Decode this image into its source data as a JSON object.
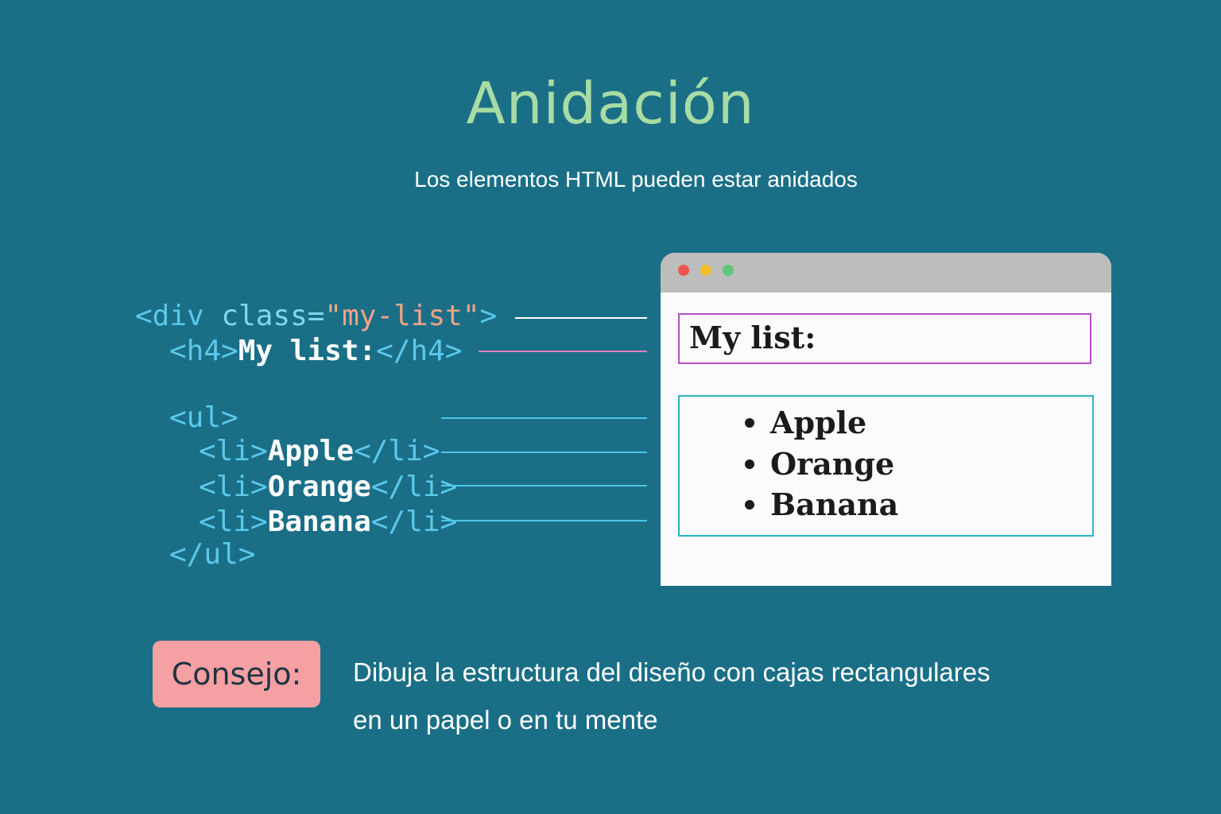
{
  "title": "Anidación",
  "subtitle": "Los elementos HTML pueden estar anidados",
  "code": {
    "div_open_tag": "<div",
    "div_class_attr": " class=",
    "div_class_value": "\"my-list\"",
    "div_close_bracket": ">",
    "h4_open": "<h4>",
    "h4_text": "My list:",
    "h4_close": "</h4>",
    "ul_open": "<ul>",
    "li_open": "<li>",
    "li_close": "</li>",
    "items": [
      "Apple",
      "Orange",
      "Banana"
    ],
    "ul_close": "</ul>"
  },
  "browser": {
    "heading": "My list:",
    "items": [
      "Apple",
      "Orange",
      "Banana"
    ]
  },
  "tip": {
    "label": "Consejo:",
    "line1": "Dibuja la estructura del diseño con cajas rectangulares",
    "line2": "en un papel o en tu mente"
  },
  "colors": {
    "background": "#1a6f87",
    "title": "#a8dca4",
    "tag": "#5cc8ec",
    "string": "#f2a386",
    "h4_outline": "#b54fc5",
    "ul_outline": "#2bb2c6",
    "tip_badge": "#f5a0a3"
  }
}
